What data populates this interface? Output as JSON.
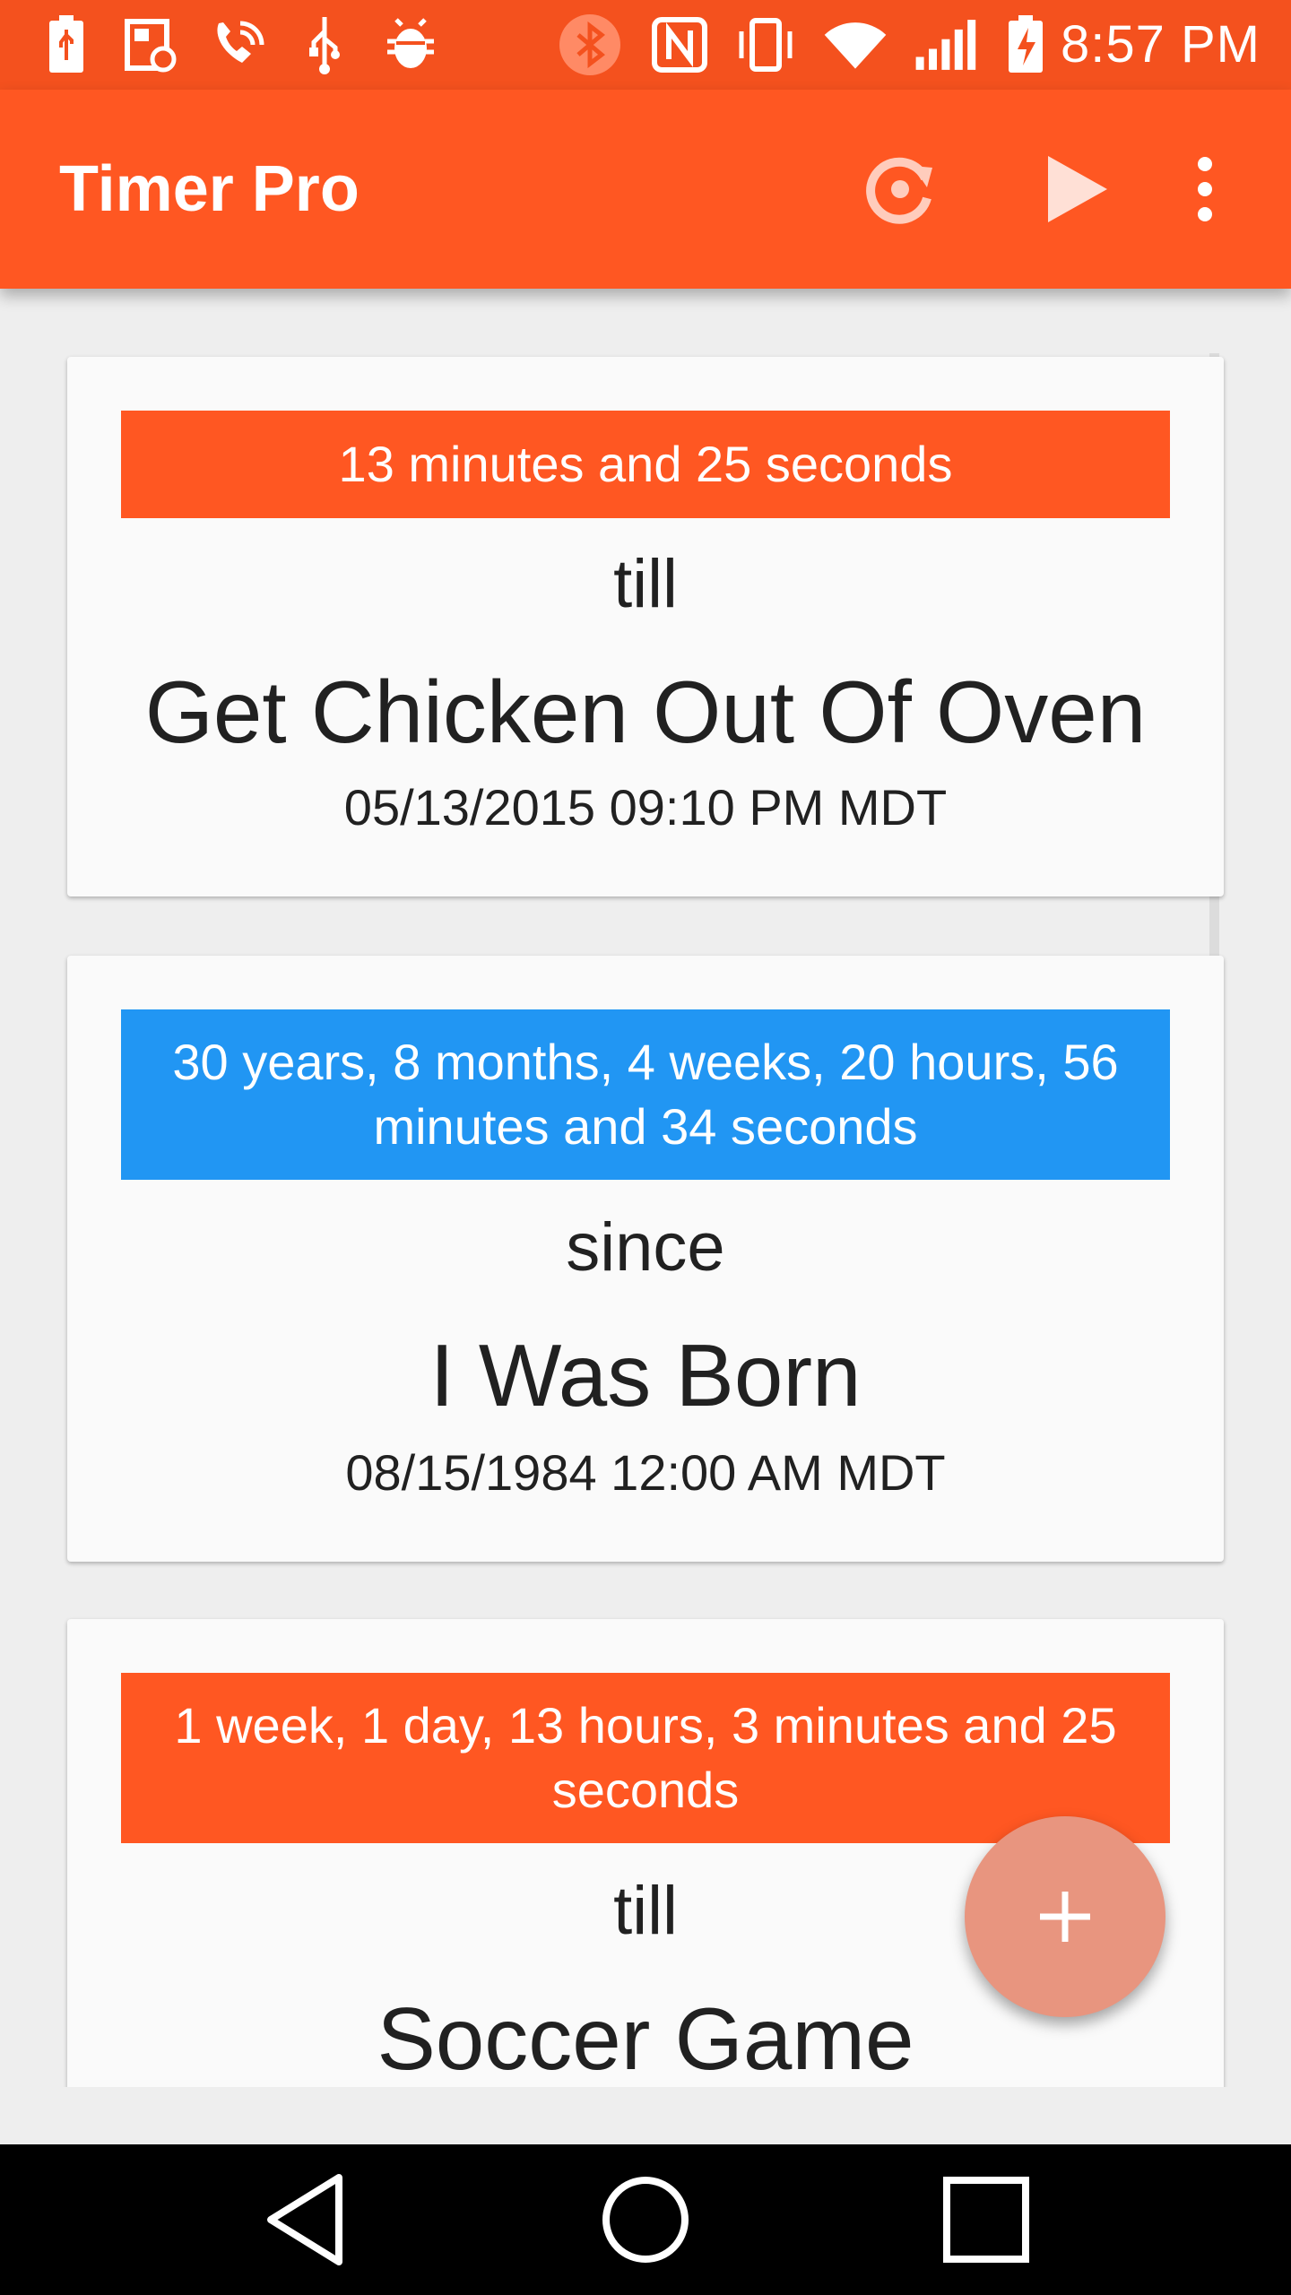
{
  "status_bar": {
    "time": "8:57 PM",
    "icons": [
      "battery-usb-icon",
      "screen-rotate-icon",
      "wifi-call-icon",
      "usb-icon",
      "android-debug-icon",
      "bluetooth-icon",
      "nfc-icon",
      "vibrate-icon",
      "wifi-icon",
      "signal-icon",
      "battery-charging-icon"
    ]
  },
  "app_bar": {
    "title": "Timer Pro",
    "actions": [
      "refresh-icon",
      "play-icon",
      "overflow-menu-icon"
    ]
  },
  "timers": [
    {
      "countdown": "13 minutes and 25 seconds",
      "relation": "till",
      "name": "Get Chicken Out Of Oven",
      "datetime": "05/13/2015 09:10 PM MDT",
      "banner_color": "#ff5722"
    },
    {
      "countdown": "30 years, 8 months, 4 weeks, 20 hours, 56 minutes and 34 seconds",
      "relation": "since",
      "name": "I Was Born",
      "datetime": "08/15/1984 12:00 AM MDT",
      "banner_color": "#2196f3"
    },
    {
      "countdown": "1 week, 1 day, 13 hours, 3 minutes and 25 seconds",
      "relation": "till",
      "name": "Soccer Game",
      "datetime": "",
      "banner_color": "#ff5722"
    }
  ],
  "fab": {
    "icon": "plus-icon",
    "color": "#e8957f"
  },
  "nav_bar": {
    "buttons": [
      "back-icon",
      "home-icon",
      "recents-icon"
    ]
  },
  "colors": {
    "status_bar": "#f4511e",
    "app_bar": "#ff5722",
    "background": "#eeeeee",
    "card": "#fafafa"
  }
}
